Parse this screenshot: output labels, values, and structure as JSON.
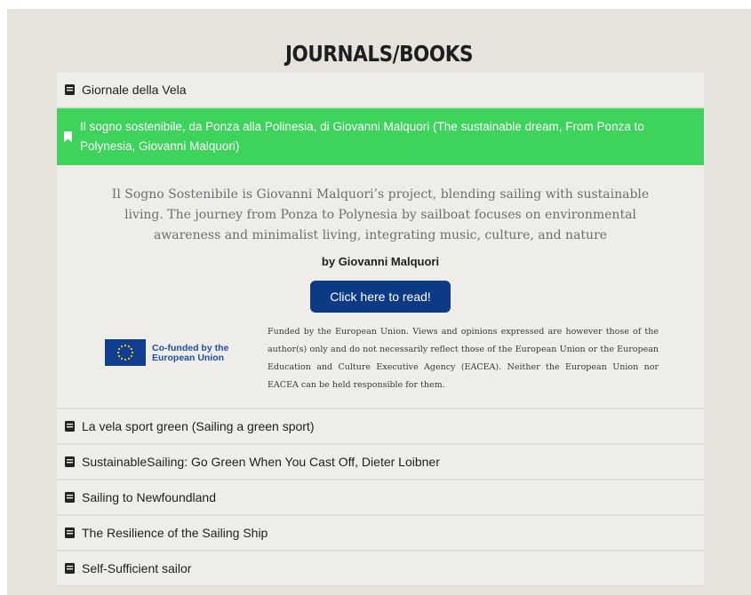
{
  "page": {
    "title": "JOURNALS/BOOKS"
  },
  "accordion": {
    "items": [
      {
        "label": "Giornale della Vela"
      },
      {
        "label": "Il sogno sostenibile, da Ponza alla Polinesia, di Giovanni Malquori (The sustainable dream, From Ponza to Polynesia, Giovanni Malquori)"
      },
      {
        "label": "La vela sport green (Sailing a green sport)"
      },
      {
        "label": "SustainableSailing: Go Green When You Cast Off, Dieter Loibner"
      },
      {
        "label": "Sailing to Newfoundland"
      },
      {
        "label": "The Resilience of the Sailing Ship"
      },
      {
        "label": "Self-Sufficient sailor"
      }
    ],
    "expanded": {
      "description": "Il Sogno Sostenibile is Giovanni Malquori’s project, blending sailing with sustainable living. The journey from Ponza to Polynesia by sailboat focuses on environmental awareness and minimalist living, integrating music, culture, and nature",
      "author": "by Giovanni Malquori",
      "button_label": "Click here to read!",
      "eu_logo_text": "Co-funded by the European Union",
      "disclaimer": "Funded by the European Union. Views and opinions expressed are however those of the author(s) only and do not necessarily reflect those of the European Union or the European Education and Culture Executive Agency (EACEA). Neither the European Union nor EACEA can be held responsible for them."
    }
  },
  "colors": {
    "accent_active": "#3ed45c",
    "button": "#0d3a85",
    "background": "#e6e2dc",
    "row": "#efedea"
  },
  "icons": {
    "collapsed": "book-icon",
    "expanded": "bookmark-icon"
  }
}
